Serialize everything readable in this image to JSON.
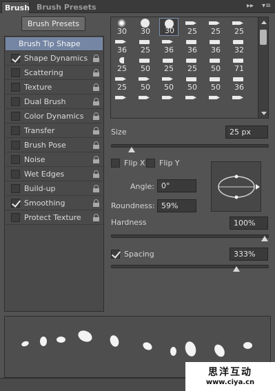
{
  "tabs": [
    "Brush",
    "Brush Presets"
  ],
  "presets_button": "Brush Presets",
  "options": [
    {
      "label": "Brush Tip Shape"
    },
    {
      "label": "Shape Dynamics",
      "checked": true
    },
    {
      "label": "Scattering",
      "checked": false
    },
    {
      "label": "Texture",
      "checked": false
    },
    {
      "label": "Dual Brush",
      "checked": false
    },
    {
      "label": "Color Dynamics",
      "checked": false
    },
    {
      "label": "Transfer",
      "checked": false
    },
    {
      "label": "Brush Pose",
      "checked": false
    },
    {
      "label": "Noise",
      "checked": false
    },
    {
      "label": "Wet Edges",
      "checked": false
    },
    {
      "label": "Build-up",
      "checked": false
    },
    {
      "label": "Smoothing",
      "checked": true
    },
    {
      "label": "Protect Texture",
      "checked": false
    }
  ],
  "brush_sizes": [
    [
      "30",
      "30",
      "30",
      "25",
      "25",
      "25"
    ],
    [
      "36",
      "25",
      "36",
      "36",
      "36",
      "32"
    ],
    [
      "25",
      "50",
      "25",
      "25",
      "50",
      "71"
    ],
    [
      "25",
      "50",
      "50",
      "50",
      "50",
      "36"
    ],
    [
      "",
      "",
      "",
      "",
      "",
      ""
    ]
  ],
  "selected_brush": "30",
  "size": {
    "label": "Size",
    "value": "25 px",
    "level": 0.11
  },
  "flip_x": {
    "label": "Flip X",
    "checked": false
  },
  "flip_y": {
    "label": "Flip Y",
    "checked": false
  },
  "angle": {
    "label": "Angle:",
    "value": "0°"
  },
  "roundness": {
    "label": "Roundness:",
    "value": "59%"
  },
  "hardness": {
    "label": "Hardness",
    "value": "100%",
    "level": 1.0
  },
  "spacing": {
    "label": "Spacing",
    "value": "333%",
    "checked": true,
    "level": 0.81
  },
  "watermark": {
    "title": "思洋互动",
    "url": "www.ciya.cn"
  }
}
